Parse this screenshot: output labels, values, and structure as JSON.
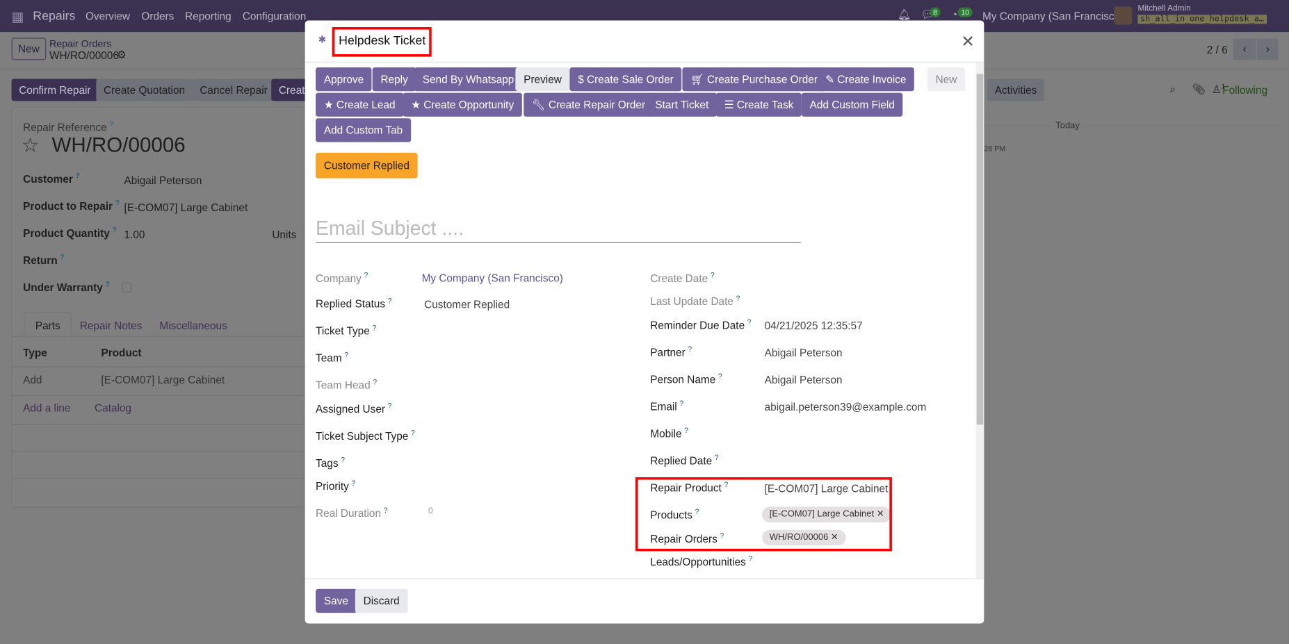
{
  "navbar": {
    "app": "Repairs",
    "menu": [
      "Overview",
      "Orders",
      "Reporting",
      "Configuration"
    ],
    "messages_count": "8",
    "activities_count": "10",
    "company": "My Company (San Francisco)",
    "user": "Mitchell Admin",
    "database": "sh_all_in_one_helpdesk_a…"
  },
  "control": {
    "new": "New",
    "breadcrumb_parent": "Repair Orders",
    "breadcrumb_current": "WH/RO/00006",
    "pager": "2 / 6"
  },
  "actions": [
    "Confirm Repair",
    "Create Quotation",
    "Cancel Repair",
    "Create"
  ],
  "chatter": {
    "activities": "Activities",
    "followers": "1",
    "following": "Following",
    "today": "Today",
    "time": "28 PM"
  },
  "form": {
    "ref_label": "Repair Reference",
    "ref": "WH/RO/00006",
    "fields": [
      {
        "label": "Customer",
        "value": "Abigail Peterson"
      },
      {
        "label": "Product to Repair",
        "value": "[E-COM07] Large Cabinet"
      },
      {
        "label": "Product Quantity",
        "value": "1.00",
        "unit": "Units"
      },
      {
        "label": "Return",
        "value": ""
      },
      {
        "label": "Under Warranty",
        "value": ""
      }
    ],
    "tabs": [
      "Parts",
      "Repair Notes",
      "Miscellaneous"
    ],
    "table": {
      "headers": [
        "Type",
        "Product"
      ],
      "rows": [
        [
          "Add",
          "[E-COM07] Large Cabinet"
        ]
      ],
      "add_line": "Add a line",
      "catalog": "Catalog"
    }
  },
  "modal": {
    "title": "Helpdesk Ticket",
    "buttons": [
      "Approve",
      "Reply",
      "Send By Whatsapp",
      "Preview",
      "Create Sale Order",
      "Create Purchase Order",
      "Create Invoice",
      "New",
      "Create Lead",
      "Create Opportunity",
      "Create Repair Order",
      "Start Ticket",
      "Create Task",
      "Add Custom Field",
      "Add Custom Tab"
    ],
    "status": "Customer Replied",
    "subject_placeholder": "Email Subject ....",
    "left": [
      {
        "label": "Company",
        "value": "My Company (San Francisco)"
      },
      {
        "label": "Replied Status",
        "value": "Customer Replied"
      },
      {
        "label": "Ticket Type",
        "value": ""
      },
      {
        "label": "Team",
        "value": ""
      },
      {
        "label": "Team Head",
        "value": ""
      },
      {
        "label": "Assigned User",
        "value": ""
      },
      {
        "label": "Ticket Subject Type",
        "value": ""
      },
      {
        "label": "Tags",
        "value": ""
      },
      {
        "label": "Priority",
        "value": ""
      },
      {
        "label": "Real Duration",
        "value": "0"
      }
    ],
    "right": [
      {
        "label": "Create Date",
        "value": ""
      },
      {
        "label": "Last Update Date",
        "value": ""
      },
      {
        "label": "Reminder Due Date",
        "value": "04/21/2025 12:35:57"
      },
      {
        "label": "Partner",
        "value": "Abigail Peterson"
      },
      {
        "label": "Person Name",
        "value": "Abigail Peterson"
      },
      {
        "label": "Email",
        "value": "abigail.peterson39@example.com"
      },
      {
        "label": "Mobile",
        "value": ""
      },
      {
        "label": "Replied Date",
        "value": ""
      },
      {
        "label": "Repair Product",
        "value": "[E-COM07] Large Cabinet"
      },
      {
        "label": "Products",
        "value": "[E-COM07] Large Cabinet"
      },
      {
        "label": "Repair Orders",
        "value": "WH/RO/00006"
      },
      {
        "label": "Leads/Opportunities",
        "value": ""
      }
    ],
    "save": "Save",
    "discard": "Discard"
  },
  "colors": {
    "primary": "#71639e",
    "warning": "#f7a428",
    "highlight": "#ff0000"
  }
}
